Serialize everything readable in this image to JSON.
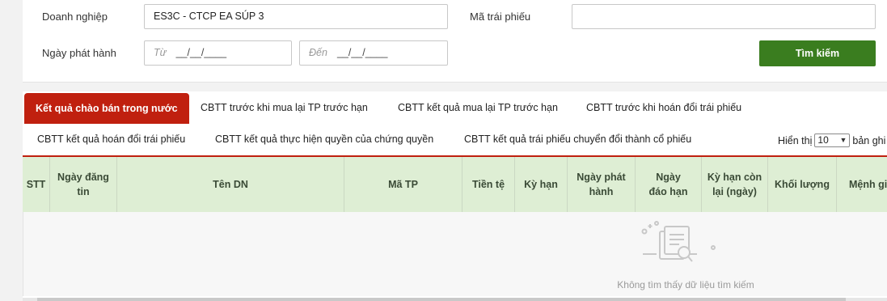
{
  "search": {
    "company_label": "Doanh nghiệp",
    "company_value": "ES3C - CTCP EA SÚP 3",
    "bond_code_label": "Mã trái phiếu",
    "bond_code_value": "",
    "issue_date_label": "Ngày phát hành",
    "from_placeholder": "Từ",
    "from_mask": "__/__/____",
    "to_placeholder": "Đến",
    "to_mask": "__/__/____",
    "search_button": "Tìm kiếm"
  },
  "tabs": [
    {
      "label": "Kết quả chào bán trong nước",
      "active": true
    },
    {
      "label": "CBTT trước khi mua lại TP trước hạn"
    },
    {
      "label": "CBTT kết quả mua lại TP trước hạn"
    },
    {
      "label": "CBTT trước khi hoán đổi trái phiếu"
    },
    {
      "label": "CBTT kết quả hoán đổi trái phiếu"
    },
    {
      "label": "CBTT kết quả thực hiện quyền của chứng quyền"
    },
    {
      "label": "CBTT kết quả trái phiếu chuyển đổi thành cổ phiếu"
    }
  ],
  "page_size": {
    "prefix": "Hiển thị",
    "value": "10",
    "suffix": "bản ghi"
  },
  "table": {
    "columns": [
      "STT",
      "Ngày đăng tin",
      "Tên DN",
      "Mã TP",
      "Tiền tệ",
      "Kỳ hạn",
      "Ngày phát hành",
      "Ngày đáo hạn",
      "Kỳ hạn còn lại (ngày)",
      "Khối lượng",
      "Mệnh giá"
    ],
    "empty_message": "Không tìm thấy dữ liệu tìm kiếm"
  },
  "colors": {
    "accent": "#c0200f",
    "button": "#3a7d1f",
    "header_bg": "#deeed4"
  }
}
